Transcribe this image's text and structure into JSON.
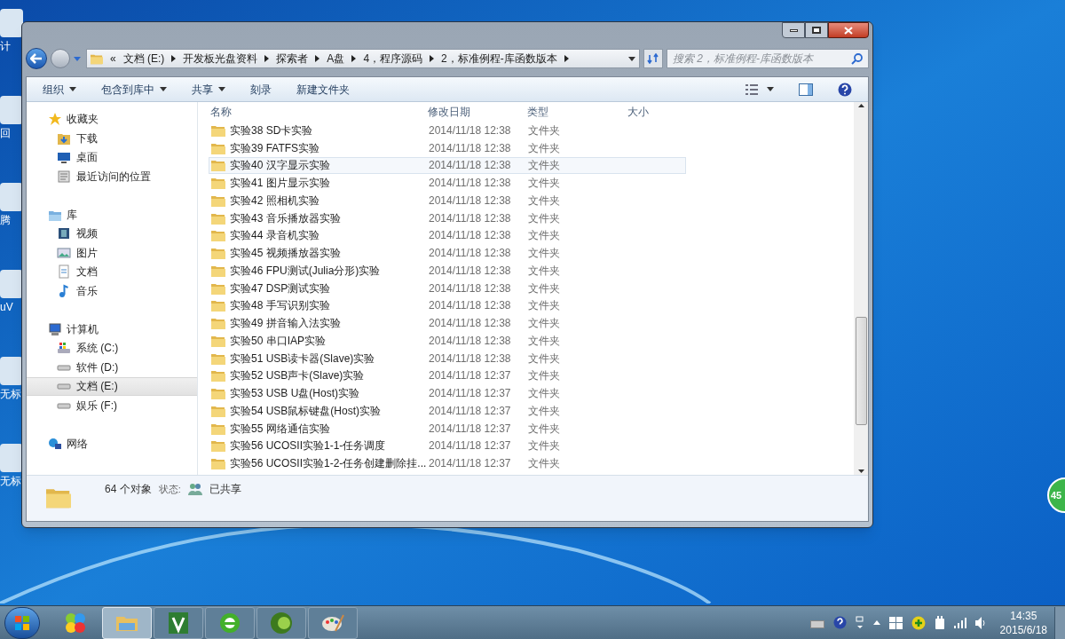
{
  "desktop_icons": [
    {
      "label": "计"
    },
    {
      "label": "回"
    },
    {
      "label": "腾"
    },
    {
      "label": "uV"
    },
    {
      "label": "无标"
    },
    {
      "label": "无标"
    }
  ],
  "window": {
    "breadcrumb": [
      "«",
      "文档 (E:)",
      "开发板光盘资料",
      "探索者",
      "A盘",
      "4，程序源码",
      "2，标准例程-库函数版本"
    ],
    "search": {
      "placeholder": "搜索 2，标准例程-库函数版本"
    },
    "toolbar": [
      {
        "label": "组织",
        "dropdown": true
      },
      {
        "label": "包含到库中",
        "dropdown": true
      },
      {
        "label": "共享",
        "dropdown": true
      },
      {
        "label": "刻录",
        "dropdown": false
      },
      {
        "label": "新建文件夹",
        "dropdown": false
      }
    ],
    "sidebar": [
      {
        "label": "收藏夹",
        "kind": "star",
        "children": [
          {
            "label": "下载",
            "kind": "download",
            "selected": false
          },
          {
            "label": "桌面",
            "kind": "desktop",
            "selected": false
          },
          {
            "label": "最近访问的位置",
            "kind": "recent",
            "selected": false
          }
        ]
      },
      {
        "label": "库",
        "kind": "library",
        "children": [
          {
            "label": "视频",
            "kind": "video",
            "selected": false
          },
          {
            "label": "图片",
            "kind": "image",
            "selected": false
          },
          {
            "label": "文档",
            "kind": "doc",
            "selected": false
          },
          {
            "label": "音乐",
            "kind": "music",
            "selected": false
          }
        ]
      },
      {
        "label": "计算机",
        "kind": "computer",
        "children": [
          {
            "label": "系统 (C:)",
            "kind": "sysdrive",
            "selected": false
          },
          {
            "label": "软件 (D:)",
            "kind": "drive",
            "selected": false
          },
          {
            "label": "文档 (E:)",
            "kind": "drive",
            "selected": true
          },
          {
            "label": "娱乐 (F:)",
            "kind": "drive",
            "selected": false
          }
        ]
      },
      {
        "label": "网络",
        "kind": "network"
      }
    ],
    "columns": [
      "名称",
      "修改日期",
      "类型",
      "大小"
    ],
    "rows": [
      {
        "name": "实验38 SD卡实验",
        "date": "2014/11/18 12:38",
        "type": "文件夹",
        "hovered": false
      },
      {
        "name": "实验39 FATFS实验",
        "date": "2014/11/18 12:38",
        "type": "文件夹",
        "hovered": false
      },
      {
        "name": "实验40 汉字显示实验",
        "date": "2014/11/18 12:38",
        "type": "文件夹",
        "hovered": true
      },
      {
        "name": "实验41 图片显示实验",
        "date": "2014/11/18 12:38",
        "type": "文件夹",
        "hovered": false
      },
      {
        "name": "实验42 照相机实验",
        "date": "2014/11/18 12:38",
        "type": "文件夹",
        "hovered": false
      },
      {
        "name": "实验43 音乐播放器实验",
        "date": "2014/11/18 12:38",
        "type": "文件夹",
        "hovered": false
      },
      {
        "name": "实验44 录音机实验",
        "date": "2014/11/18 12:38",
        "type": "文件夹",
        "hovered": false
      },
      {
        "name": "实验45 视频播放器实验",
        "date": "2014/11/18 12:38",
        "type": "文件夹",
        "hovered": false
      },
      {
        "name": "实验46 FPU测试(Julia分形)实验",
        "date": "2014/11/18 12:38",
        "type": "文件夹",
        "hovered": false
      },
      {
        "name": "实验47 DSP测试实验",
        "date": "2014/11/18 12:38",
        "type": "文件夹",
        "hovered": false
      },
      {
        "name": "实验48 手写识别实验",
        "date": "2014/11/18 12:38",
        "type": "文件夹",
        "hovered": false
      },
      {
        "name": "实验49 拼音输入法实验",
        "date": "2014/11/18 12:38",
        "type": "文件夹",
        "hovered": false
      },
      {
        "name": "实验50 串口IAP实验",
        "date": "2014/11/18 12:38",
        "type": "文件夹",
        "hovered": false
      },
      {
        "name": "实验51 USB读卡器(Slave)实验",
        "date": "2014/11/18 12:38",
        "type": "文件夹",
        "hovered": false
      },
      {
        "name": "实验52 USB声卡(Slave)实验",
        "date": "2014/11/18 12:37",
        "type": "文件夹",
        "hovered": false
      },
      {
        "name": "实验53 USB U盘(Host)实验",
        "date": "2014/11/18 12:37",
        "type": "文件夹",
        "hovered": false
      },
      {
        "name": "实验54 USB鼠标键盘(Host)实验",
        "date": "2014/11/18 12:37",
        "type": "文件夹",
        "hovered": false
      },
      {
        "name": "实验55 网络通信实验",
        "date": "2014/11/18 12:37",
        "type": "文件夹",
        "hovered": false
      },
      {
        "name": "实验56 UCOSII实验1-1-任务调度",
        "date": "2014/11/18 12:37",
        "type": "文件夹",
        "hovered": false
      },
      {
        "name": "实验56 UCOSII实验1-2-任务创建删除挂...",
        "date": "2014/11/18 12:37",
        "type": "文件夹",
        "hovered": false
      }
    ],
    "status": {
      "count": "64 个对象",
      "state_label": "状态:",
      "state": "已共享"
    }
  },
  "floating_badge": "45",
  "taskbar": {
    "apps": [
      {
        "kind": "orbs",
        "active": false
      },
      {
        "kind": "explorer",
        "active": true
      },
      {
        "kind": "mu",
        "active": false
      },
      {
        "kind": "browser",
        "active": false
      },
      {
        "kind": "q4",
        "active": false
      },
      {
        "kind": "paint",
        "active": false
      }
    ],
    "clock": {
      "time": "14:35",
      "date": "2015/6/18"
    }
  }
}
